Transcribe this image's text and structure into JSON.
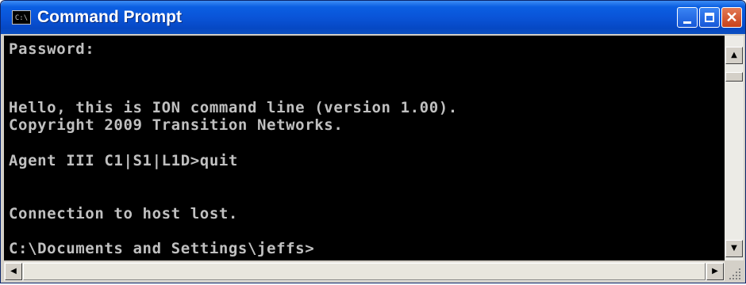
{
  "window": {
    "title": "Command Prompt",
    "icon_label": "C:\\",
    "controls": {
      "minimize": "minimize-icon",
      "maximize": "maximize-icon",
      "close": "close-icon",
      "close_glyph": "✕"
    }
  },
  "console": {
    "lines": [
      "Password:",
      "Hello, this is ION command line (version 1.00).",
      "Copyright 2009 Transition Networks.",
      "Agent III C1|S1|L1D>quit",
      "Connection to host lost.",
      "C:\\Documents and Settings\\jeffs>"
    ],
    "colors": {
      "background": "#000000",
      "text": "#c0c0c0"
    }
  },
  "scrollbars": {
    "up_arrow": "▲",
    "down_arrow": "▼",
    "left_arrow": "◀",
    "right_arrow": "▶"
  },
  "colors": {
    "titlebar": "#0a54d8",
    "close_button": "#c8411a",
    "frame": "#d4d0c8"
  }
}
